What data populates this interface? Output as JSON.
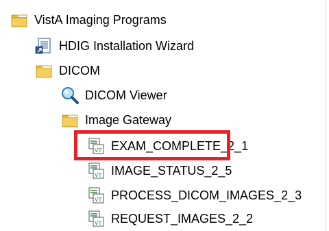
{
  "tree": {
    "items": [
      {
        "label": "VistA Imaging Programs",
        "icon": "folder-icon",
        "level": 0
      },
      {
        "label": "HDIG Installation Wizard",
        "icon": "document-program-icon",
        "level": 1
      },
      {
        "label": "DICOM",
        "icon": "folder-icon",
        "level": 1
      },
      {
        "label": "DICOM Viewer",
        "icon": "magnifier-icon",
        "level": 2
      },
      {
        "label": "Image Gateway",
        "icon": "folder-icon",
        "level": 2
      },
      {
        "label": "EXAM_COMPLETE_2_1",
        "icon": "mumps-routine-icon",
        "level": 3
      },
      {
        "label": "IMAGE_STATUS_2_5",
        "icon": "mumps-routine-icon",
        "level": 3
      },
      {
        "label": "PROCESS_DICOM_IMAGES_2_3",
        "icon": "mumps-routine-icon",
        "level": 3
      },
      {
        "label": "REQUEST_IMAGES_2_2",
        "icon": "mumps-routine-icon",
        "level": 3
      }
    ]
  },
  "highlight": {
    "target": "EXAM_COMPLETE_2_1",
    "color": "#e8202a"
  },
  "colors": {
    "folder_yellow": "#f2c94c",
    "folder_dark": "#c99a1f",
    "routine_green": "#2e8b3d"
  }
}
